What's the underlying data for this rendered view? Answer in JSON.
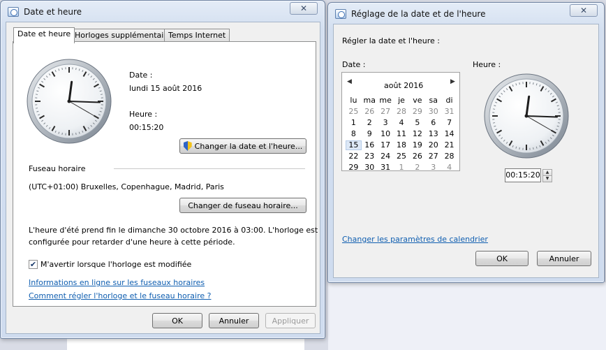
{
  "left_window": {
    "title": "Date et heure",
    "close": "✕",
    "tabs": [
      "Date et heure",
      "Horloges supplémentaires",
      "Temps Internet"
    ],
    "date_label": "Date :",
    "date_value": "lundi 15 août 2016",
    "time_label": "Heure :",
    "time_value": "00:15:20",
    "change_datetime_button": "Changer la date et l'heure...",
    "timezone_header": "Fuseau horaire",
    "timezone_value": "(UTC+01:00) Bruxelles, Copenhague, Madrid, Paris",
    "change_timezone_button": "Changer de fuseau horaire...",
    "dst_line1": "L'heure d'été prend fin le dimanche 30 octobre 2016 à 03:00. L'horloge est",
    "dst_line2": "configurée pour retarder d'une heure à cette période.",
    "notify_checkbox_label": "M'avertir lorsque l'horloge est modifiée",
    "notify_checked": true,
    "link_online_info": "Informations en ligne sur les fuseaux horaires",
    "link_how_to": "Comment régler l'horloge et le fuseau horaire ?",
    "ok": "OK",
    "cancel": "Annuler",
    "apply": "Appliquer"
  },
  "right_window": {
    "title": "Réglage de la date et de l'heure",
    "close": "✕",
    "heading": "Régler la date et l'heure :",
    "date_label": "Date :",
    "time_label": "Heure :",
    "calendar": {
      "month": "août 2016",
      "prev": "◀",
      "next": "▶",
      "weekdays": [
        "lu",
        "ma",
        "me",
        "je",
        "ve",
        "sa",
        "di"
      ],
      "weeks": [
        [
          "25",
          "26",
          "27",
          "28",
          "29",
          "30",
          "31"
        ],
        [
          "1",
          "2",
          "3",
          "4",
          "5",
          "6",
          "7"
        ],
        [
          "8",
          "9",
          "10",
          "11",
          "12",
          "13",
          "14"
        ],
        [
          "15",
          "16",
          "17",
          "18",
          "19",
          "20",
          "21"
        ],
        [
          "22",
          "23",
          "24",
          "25",
          "26",
          "27",
          "28"
        ],
        [
          "29",
          "30",
          "31",
          "1",
          "2",
          "3",
          "4"
        ]
      ],
      "selected": "15"
    },
    "time_value": "00:15:20",
    "spin_up": "▲",
    "spin_down": "▼",
    "calendar_link": "Changer les paramètres de calendrier",
    "ok": "OK",
    "cancel": "Annuler"
  },
  "clock": {
    "hour": 0,
    "minute": 15,
    "second": 20
  }
}
